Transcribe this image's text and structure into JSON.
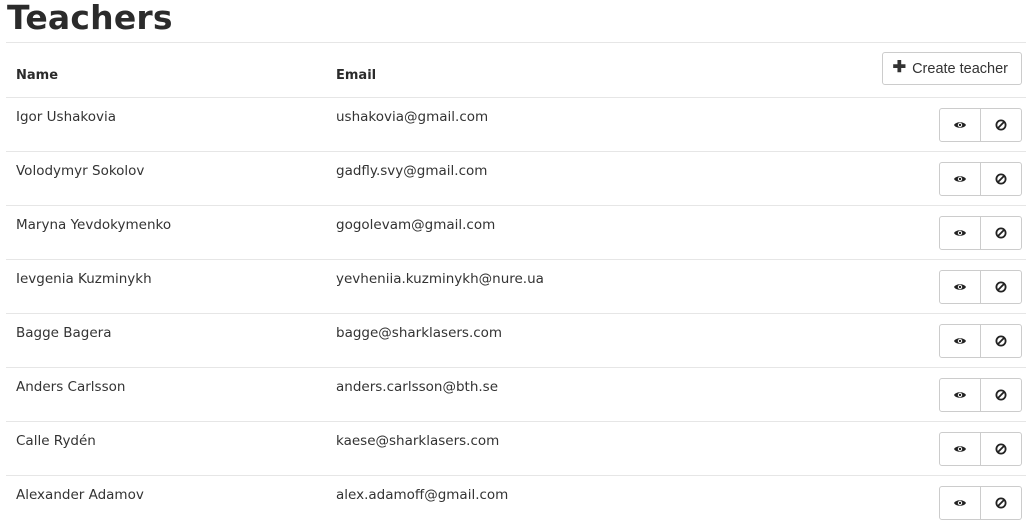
{
  "page": {
    "title": "Teachers"
  },
  "table": {
    "columns": {
      "name": "Name",
      "email": "Email"
    },
    "create_button": {
      "icon": "plus-icon",
      "label": "Create teacher"
    },
    "row_actions": [
      "eye-icon",
      "ban-icon"
    ],
    "rows": [
      {
        "name": "Igor Ushakovia",
        "email": "ushakovia@gmail.com"
      },
      {
        "name": "Volodymyr Sokolov",
        "email": "gadfly.svy@gmail.com"
      },
      {
        "name": "Maryna Yevdokymenko",
        "email": "gogolevam@gmail.com"
      },
      {
        "name": "Ievgenia Kuzminykh",
        "email": "yevheniia.kuzminykh@nure.ua"
      },
      {
        "name": "Bagge Bagera",
        "email": "bagge@sharklasers.com"
      },
      {
        "name": "Anders Carlsson",
        "email": "anders.carlsson@bth.se"
      },
      {
        "name": "Calle Rydén",
        "email": "kaese@sharklasers.com"
      },
      {
        "name": "Alexander Adamov",
        "email": "alex.adamoff@gmail.com"
      }
    ]
  }
}
